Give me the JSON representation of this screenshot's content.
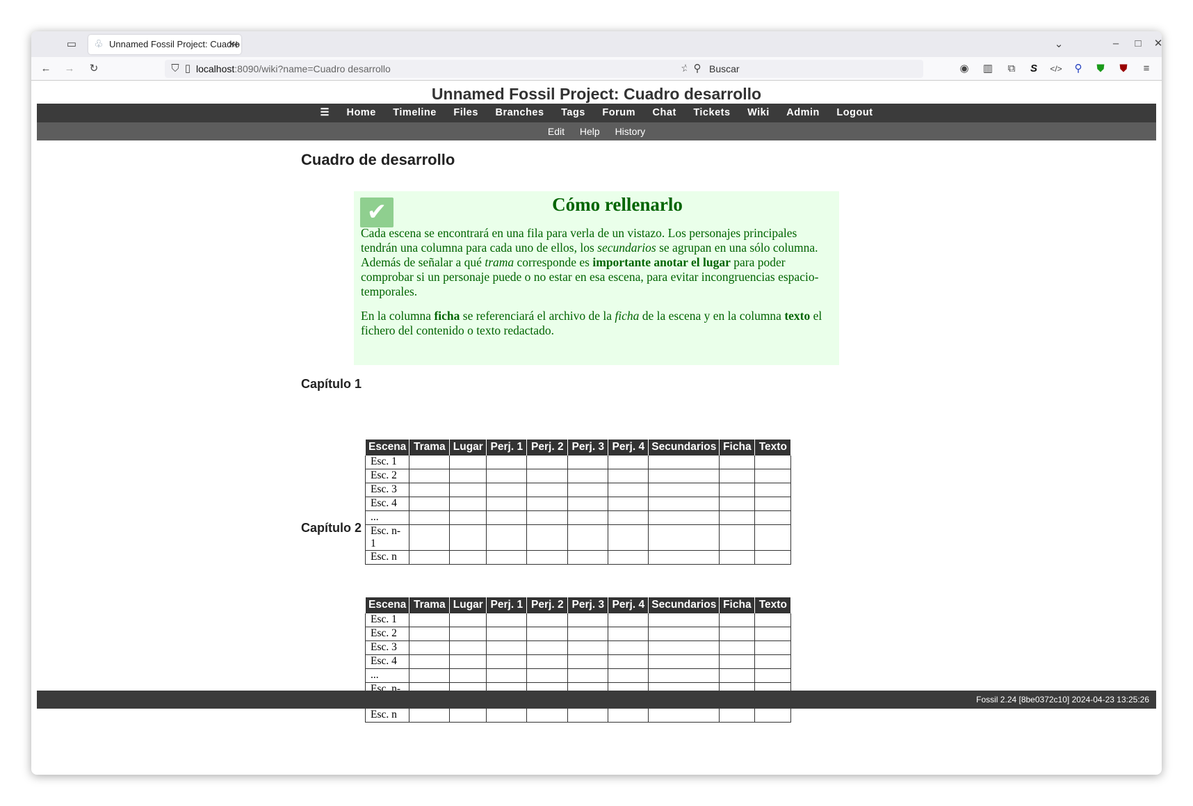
{
  "browser": {
    "tab_title": "Unnamed Fossil Project: Cuadro desarrollo",
    "url_host": "localhost",
    "url_rest": ":8090/wiki?name=Cuadro desarrollo",
    "search_placeholder": "Buscar"
  },
  "site": {
    "title": "Unnamed Fossil Project: Cuadro desarrollo",
    "menu": [
      "Home",
      "Timeline",
      "Files",
      "Branches",
      "Tags",
      "Forum",
      "Chat",
      "Tickets",
      "Wiki",
      "Admin",
      "Logout"
    ],
    "submenu": [
      "Edit",
      "Help",
      "History"
    ]
  },
  "page": {
    "heading": "Cuadro de desarrollo",
    "note": {
      "title": "Cómo rellenarlo",
      "p1": [
        "Cada escena se encontrará en una fila para verla de un vistazo. Los personajes principales tendrán una columna para cada uno de ellos, los ",
        "secundarios",
        " se agrupan en una sólo columna. Además de señalar a qué ",
        "trama",
        " corresponde es ",
        "importante anotar el lugar",
        " para poder comprobar si un personaje puede o no estar en esa escena, para evitar incongruencias espacio-temporales."
      ],
      "p2": [
        "En la columna ",
        "ficha",
        " se referenciará el archivo de la ",
        "ficha",
        " de la escena y en la columna ",
        "texto",
        " el fichero del contenido o texto redactado."
      ]
    },
    "chapters": [
      {
        "title": "Capítulo 1"
      },
      {
        "title": "Capítulo 2"
      }
    ],
    "columns": [
      "Escena",
      "Trama",
      "Lugar",
      "Perj. 1",
      "Perj. 2",
      "Perj. 3",
      "Perj. 4",
      "Secundarios",
      "Ficha",
      "Texto"
    ],
    "rows": [
      "Esc. 1",
      "Esc. 2",
      "Esc. 3",
      "Esc. 4",
      "...",
      "Esc. n-1",
      "Esc. n"
    ]
  },
  "footer": "Fossil 2.24 [8be0372c10] 2024-04-23 13:25:26"
}
